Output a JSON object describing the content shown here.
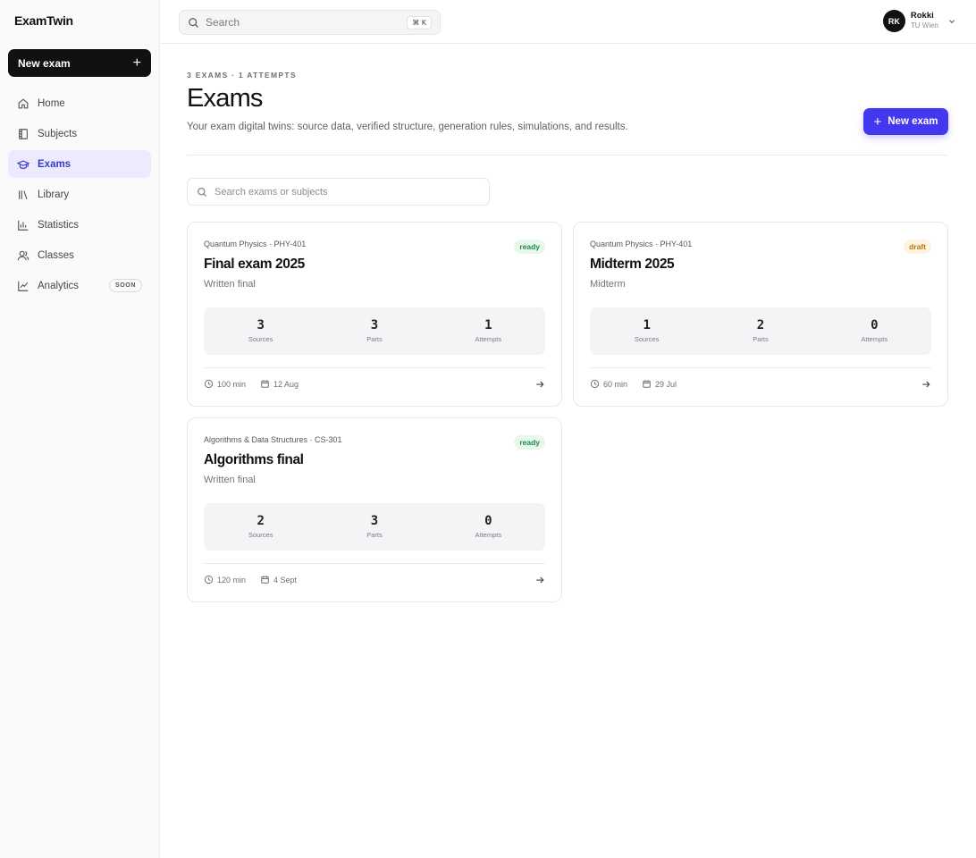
{
  "app": {
    "brand": "ExamTwin",
    "new_exam_label": "New exam"
  },
  "sidebar": {
    "items": [
      {
        "label": "Home",
        "icon": "home-icon"
      },
      {
        "label": "Subjects",
        "icon": "book-icon"
      },
      {
        "label": "Exams",
        "icon": "graduation-cap-icon",
        "active": true
      },
      {
        "label": "Library",
        "icon": "library-icon"
      },
      {
        "label": "Statistics",
        "icon": "bar-chart-icon"
      },
      {
        "label": "Classes",
        "icon": "users-icon"
      },
      {
        "label": "Analytics",
        "icon": "line-chart-icon",
        "badge": "SOON"
      }
    ]
  },
  "topbar": {
    "search_placeholder": "Search",
    "shortcut": "⌘ K",
    "user": {
      "initials": "RK",
      "name": "Rokki",
      "org": "TU Wien"
    }
  },
  "header": {
    "eyebrow": "3 EXAMS · 1 ATTEMPTS",
    "title": "Exams",
    "subtitle": "Your exam digital twins: source data, verified structure, generation rules, simulations, and results.",
    "new_exam_label": "New exam",
    "search_placeholder": "Search exams or subjects"
  },
  "exams": [
    {
      "subject": "Quantum Physics · PHY-401",
      "status": "ready",
      "name": "Final exam 2025",
      "kind": "Written final",
      "stats": [
        {
          "value": "3",
          "label": "Sources"
        },
        {
          "value": "3",
          "label": "Parts"
        },
        {
          "value": "1",
          "label": "Attempts"
        }
      ],
      "duration": "100 min",
      "date": "12 Aug"
    },
    {
      "subject": "Quantum Physics · PHY-401",
      "status": "draft",
      "name": "Midterm 2025",
      "kind": "Midterm",
      "stats": [
        {
          "value": "1",
          "label": "Sources"
        },
        {
          "value": "2",
          "label": "Parts"
        },
        {
          "value": "0",
          "label": "Attempts"
        }
      ],
      "duration": "60 min",
      "date": "29 Jul"
    },
    {
      "subject": "Algorithms & Data Structures · CS-301",
      "status": "ready",
      "name": "Algorithms final",
      "kind": "Written final",
      "stats": [
        {
          "value": "2",
          "label": "Sources"
        },
        {
          "value": "3",
          "label": "Parts"
        },
        {
          "value": "0",
          "label": "Attempts"
        }
      ],
      "duration": "120 min",
      "date": "4 Sept"
    }
  ]
}
